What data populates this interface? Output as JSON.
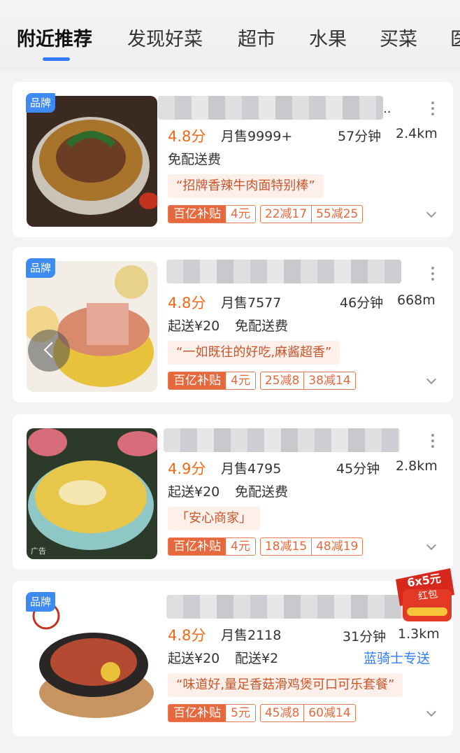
{
  "tabs": [
    "附近推荐",
    "发现好菜",
    "超市",
    "水果",
    "买菜",
    "医"
  ],
  "active_tab": 0,
  "accent_color": "#2f7cf6",
  "brand_color": "#f06a15",
  "stores": [
    {
      "brand_tag": "品牌",
      "title_visible_suffix": "..",
      "rating": "4.8分",
      "monthly_sales": "月售9999+",
      "delivery_time": "57分钟",
      "distance": "2.4km",
      "fee_line": "免配送费",
      "quote": "“招牌香辣牛肉面特别棒”",
      "subsidy_label": "百亿补贴",
      "subsidy_amount": "4元",
      "coupons": [
        "22减17",
        "55减25"
      ]
    },
    {
      "brand_tag": "品牌",
      "rating": "4.8分",
      "monthly_sales": "月售7577",
      "delivery_time": "46分钟",
      "distance": "668m",
      "min_order": "起送¥20",
      "fee_line": "免配送费",
      "quote": "“一如既往的好吃,麻酱超香”",
      "subsidy_label": "百亿补贴",
      "subsidy_amount": "4元",
      "coupons": [
        "25减8",
        "38减14"
      ]
    },
    {
      "ad_tag": "广告",
      "rating": "4.9分",
      "monthly_sales": "月售4795",
      "delivery_time": "45分钟",
      "distance": "2.8km",
      "min_order": "起送¥20",
      "fee_line": "免配送费",
      "quote": "「安心商家」",
      "subsidy_label": "百亿补贴",
      "subsidy_amount": "4元",
      "coupons": [
        "18减15",
        "48减19"
      ]
    },
    {
      "brand_tag": "品牌",
      "rating": "4.8分",
      "monthly_sales": "月售2118",
      "delivery_time": "31分钟",
      "distance": "1.3km",
      "min_order": "起送¥20",
      "fee_line": "配送¥2",
      "rider": "蓝骑士专送",
      "quote": "“味道好,量足香菇滑鸡煲可口可乐套餐”",
      "subsidy_label": "百亿补贴",
      "subsidy_amount": "5元",
      "coupons": [
        "45减8",
        "60减14"
      ]
    }
  ],
  "hongbao": {
    "line1": "6x5元",
    "line2": "红包"
  }
}
